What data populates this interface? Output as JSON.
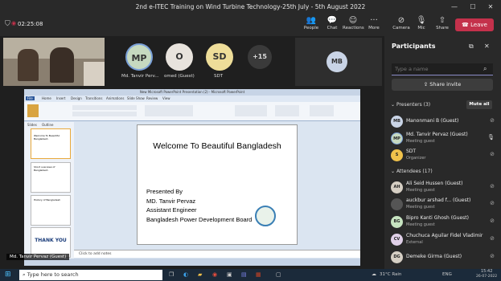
{
  "window": {
    "title": "2nd e-ITEC Training on Wind Turbine Technology-25th July - 5th August 2022"
  },
  "toolbar": {
    "timer": "02:25:08",
    "people": "People",
    "chat": "Chat",
    "reactions": "Reactions",
    "more": "More",
    "camera": "Camera",
    "mic": "Mic",
    "share": "Share",
    "leave": "Leave"
  },
  "stage": {
    "tiles": [
      {
        "initials": "MP",
        "name": "Md. Tanvir Perv...",
        "color": "#c6d9c0"
      },
      {
        "initials": "O",
        "name": "omed (Guest)",
        "color": "#e8e3dd"
      },
      {
        "initials": "SD",
        "name": "SDT",
        "color": "#eedd99"
      }
    ],
    "overflow": "+15",
    "mb_initials": "MB",
    "presenter_label": "Md. Tanvir Pervaz (Guest)"
  },
  "ppt": {
    "title": "New Microsoft PowerPoint Presentation (2) - Microsoft PowerPoint",
    "tabs": [
      "File",
      "Home",
      "Insert",
      "Design",
      "Transitions",
      "Animations",
      "Slide Show",
      "Review",
      "View"
    ],
    "pane_tabs": [
      "Slides",
      "Outline"
    ],
    "thumb_texts": [
      "Welcome To Beautiful Bangladesh",
      "Short overview of Bangladesh",
      "History of Bangladesh",
      "THANK YOU"
    ],
    "notes": "Click to add notes",
    "slide": {
      "title": "Welcome To Beautiful Bangladesh",
      "lines": [
        "Presented By",
        "MD. Tanvir Pervaz",
        "Assistant Engineer",
        "Bangladesh Power Development Board"
      ]
    }
  },
  "panel": {
    "title": "Participants",
    "search_placeholder": "Type a name",
    "share_invite": "Share invite",
    "presenters_header": "Presenters (3)",
    "mute_all": "Mute all",
    "presenters": [
      {
        "initials": "MB",
        "name": "Manonmani B (Guest)",
        "role": "",
        "color": "#c9d4e6"
      },
      {
        "initials": "MP",
        "name": "Md. Tanvir Pervaz (Guest)",
        "role": "Meeting guest",
        "color": "#c6d9c0"
      },
      {
        "initials": "S",
        "name": "SDT",
        "role": "Organizer",
        "color": "#f0c24b"
      }
    ],
    "attendees_header": "Attendees (17)",
    "attendees": [
      {
        "initials": "AH",
        "name": "Ali Seid Hussen (Guest)",
        "role": "Meeting guest",
        "color": "#d6cfc4"
      },
      {
        "initials": "",
        "name": "auckbur arshad f... (Guest)",
        "role": "Meeting guest",
        "color": "#555555"
      },
      {
        "initials": "BG",
        "name": "Bipro Kanti Ghosh (Guest)",
        "role": "Meeting guest",
        "color": "#c6e3c0"
      },
      {
        "initials": "CV",
        "name": "Chuchuca Aguilar Fidel Vladimir",
        "role": "External",
        "color": "#e0d0e8"
      },
      {
        "initials": "DG",
        "name": "Demeke Girma (Guest)",
        "role": "",
        "color": "#d6cfc4"
      }
    ]
  },
  "taskbar": {
    "search": "Type here to search",
    "weather": "31°C Rain",
    "lang": "ENG",
    "time": "15:42",
    "date": "26-07-2022"
  }
}
